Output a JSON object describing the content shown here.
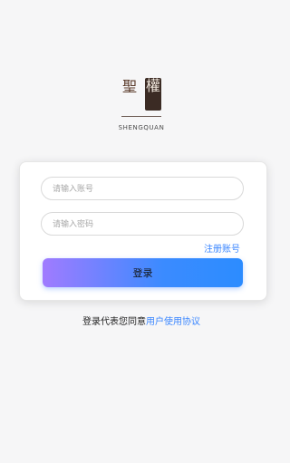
{
  "logo": {
    "left_char": "聖",
    "right_char": "權",
    "brand_text": "SHENGQUAN"
  },
  "form": {
    "account_placeholder": "请输入账号",
    "account_value": "",
    "password_placeholder": "请输入密码",
    "password_value": "",
    "register_label": "注册账号",
    "login_label": "登录"
  },
  "agreement": {
    "prefix": "登录代表您同意",
    "link": "用户使用协议"
  },
  "colors": {
    "background": "#f6f6f7",
    "link": "#3a86ff",
    "button_gradient_start": "#a07bff",
    "button_gradient_end": "#2c8cff"
  }
}
